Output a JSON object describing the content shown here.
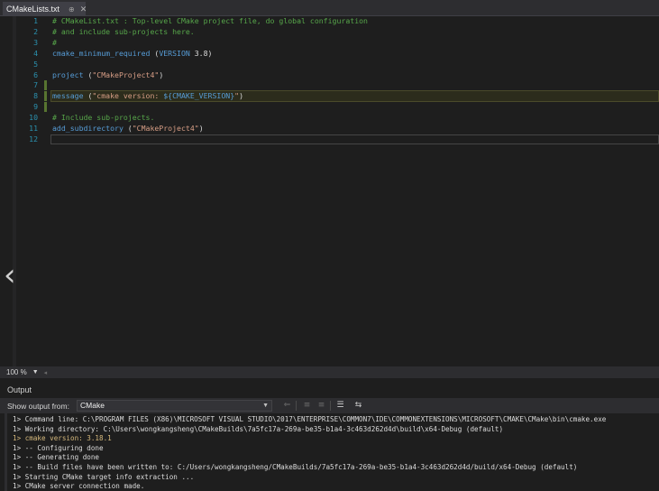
{
  "tab": {
    "title": "CMakeLists.txt",
    "pin_glyph": "⊕",
    "close_glyph": "✕"
  },
  "editor": {
    "lines": [
      {
        "n": "1",
        "parts": [
          {
            "c": "cmt",
            "t": "# CMakeList.txt : Top-level CMake project file, do global configuration"
          }
        ]
      },
      {
        "n": "2",
        "parts": [
          {
            "c": "cmt",
            "t": "# and include sub-projects here."
          }
        ]
      },
      {
        "n": "3",
        "parts": [
          {
            "c": "cmt",
            "t": "#"
          }
        ]
      },
      {
        "n": "4",
        "parts": [
          {
            "c": "kw",
            "t": "cmake_minimum_required"
          },
          {
            "c": "pl",
            "t": " ("
          },
          {
            "c": "var",
            "t": "VERSION"
          },
          {
            "c": "pl",
            "t": " 3.8)"
          }
        ]
      },
      {
        "n": "5",
        "parts": []
      },
      {
        "n": "6",
        "parts": [
          {
            "c": "kw",
            "t": "project"
          },
          {
            "c": "pl",
            "t": " ("
          },
          {
            "c": "str",
            "t": "\"CMakeProject4\""
          },
          {
            "c": "pl",
            "t": ")"
          }
        ]
      },
      {
        "n": "7",
        "parts": []
      },
      {
        "n": "8",
        "parts": [
          {
            "c": "kw",
            "t": "message"
          },
          {
            "c": "pl",
            "t": " ("
          },
          {
            "c": "str",
            "t": "\"cmake version: "
          },
          {
            "c": "var",
            "t": "${CMAKE_VERSION}"
          },
          {
            "c": "str",
            "t": "\""
          },
          {
            "c": "pl",
            "t": ")"
          }
        ]
      },
      {
        "n": "9",
        "parts": []
      },
      {
        "n": "10",
        "parts": [
          {
            "c": "cmt",
            "t": "# Include sub-projects."
          }
        ]
      },
      {
        "n": "11",
        "parts": [
          {
            "c": "kw",
            "t": "add_subdirectory"
          },
          {
            "c": "pl",
            "t": " ("
          },
          {
            "c": "str",
            "t": "\"CMakeProject4\""
          },
          {
            "c": "pl",
            "t": ")"
          }
        ]
      },
      {
        "n": "12",
        "parts": []
      }
    ],
    "changed_lines": [
      "7",
      "8",
      "9"
    ],
    "current_line": "12",
    "nav_arrow_glyph": "‹"
  },
  "zoom": {
    "value": "100 %",
    "caret": "▼",
    "scroll_glyph": "◂"
  },
  "output": {
    "title": "Output",
    "show_label": "Show output from:",
    "source": "CMake",
    "dropdown_glyph": "▼",
    "toolbar_icons": [
      {
        "name": "find-message-icon",
        "glyph": "⇐"
      },
      {
        "name": "previous-message-icon",
        "glyph": "≡"
      },
      {
        "name": "next-message-icon",
        "glyph": "≡"
      },
      {
        "name": "clear-all-icon",
        "glyph": "☰"
      },
      {
        "name": "word-wrap-icon",
        "glyph": "⇆"
      }
    ],
    "lines": [
      {
        "t": "1> Command line: C:\\PROGRAM FILES (X86)\\MICROSOFT VISUAL STUDIO\\2017\\ENTERPRISE\\COMMON7\\IDE\\COMMONEXTENSIONS\\MICROSOFT\\CMAKE\\CMake\\bin\\cmake.exe",
        "hl": false
      },
      {
        "t": "1> Working directory: C:\\Users\\wongkangsheng\\CMakeBuilds\\7a5fc17a-269a-be35-b1a4-3c463d262d4d\\build\\x64-Debug (default)",
        "hl": false
      },
      {
        "t": "1> cmake version: 3.18.1",
        "hl": true
      },
      {
        "t": "1> -- Configuring done",
        "hl": false
      },
      {
        "t": "1> -- Generating done",
        "hl": false
      },
      {
        "t": "1> -- Build files have been written to: C:/Users/wongkangsheng/CMakeBuilds/7a5fc17a-269a-be35-b1a4-3c463d262d4d/build/x64-Debug (default)",
        "hl": false
      },
      {
        "t": "1> Starting CMake target info extraction ...",
        "hl": false
      },
      {
        "t": "1> CMake server connection made.",
        "hl": false
      }
    ]
  }
}
